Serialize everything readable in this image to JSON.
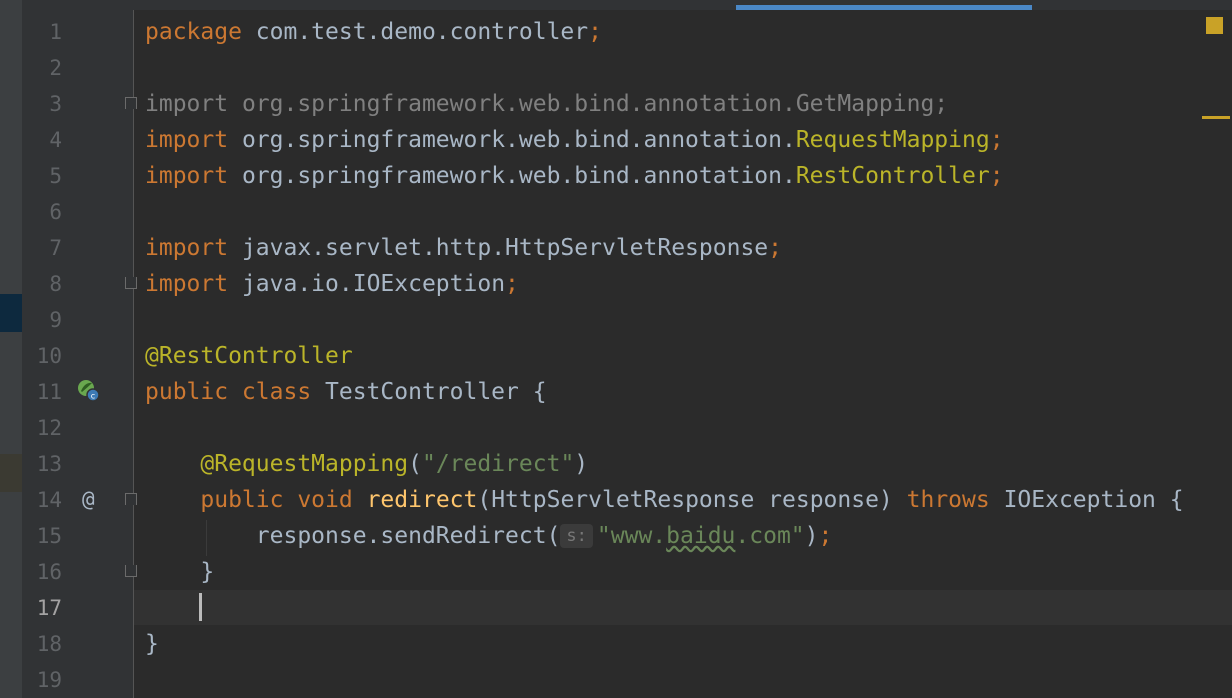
{
  "editor": {
    "line_numbers": [
      "1",
      "2",
      "3",
      "4",
      "5",
      "6",
      "7",
      "8",
      "9",
      "10",
      "11",
      "12",
      "13",
      "14",
      "15",
      "16",
      "17",
      "18",
      "19"
    ],
    "current_line": "17",
    "lines": [
      {
        "tokens": [
          {
            "t": "package",
            "c": "kw"
          },
          {
            "t": " com.test.demo.controller",
            "c": ""
          },
          {
            "t": ";",
            "c": "kw"
          }
        ]
      },
      {
        "tokens": []
      },
      {
        "tokens": [
          {
            "t": "import",
            "c": "dim"
          },
          {
            "t": " org.springframework.web.bind.annotation.GetMapping;",
            "c": "dim"
          }
        ]
      },
      {
        "tokens": [
          {
            "t": "import",
            "c": "kw"
          },
          {
            "t": " org.springframework.web.bind.annotation.",
            "c": ""
          },
          {
            "t": "RequestMapping",
            "c": "ann"
          },
          {
            "t": ";",
            "c": "kw"
          }
        ]
      },
      {
        "tokens": [
          {
            "t": "import",
            "c": "kw"
          },
          {
            "t": " org.springframework.web.bind.annotation.",
            "c": ""
          },
          {
            "t": "RestController",
            "c": "ann"
          },
          {
            "t": ";",
            "c": "kw"
          }
        ]
      },
      {
        "tokens": []
      },
      {
        "tokens": [
          {
            "t": "import",
            "c": "kw"
          },
          {
            "t": " javax.servlet.http.HttpServletResponse",
            "c": ""
          },
          {
            "t": ";",
            "c": "kw"
          }
        ]
      },
      {
        "tokens": [
          {
            "t": "import",
            "c": "kw"
          },
          {
            "t": " java.io.IOException",
            "c": ""
          },
          {
            "t": ";",
            "c": "kw"
          }
        ]
      },
      {
        "tokens": []
      },
      {
        "tokens": [
          {
            "t": "@RestController",
            "c": "ann"
          }
        ]
      },
      {
        "tokens": [
          {
            "t": "public class",
            "c": "kw"
          },
          {
            "t": " TestController {",
            "c": ""
          }
        ]
      },
      {
        "tokens": []
      },
      {
        "tokens": [
          {
            "t": "    ",
            "c": ""
          },
          {
            "t": "@RequestMapping",
            "c": "ann"
          },
          {
            "t": "(",
            "c": ""
          },
          {
            "t": "\"/redirect\"",
            "c": "str"
          },
          {
            "t": ")",
            "c": ""
          }
        ]
      },
      {
        "tokens": [
          {
            "t": "    ",
            "c": ""
          },
          {
            "t": "public void",
            "c": "kw"
          },
          {
            "t": " ",
            "c": ""
          },
          {
            "t": "redirect",
            "c": "fn"
          },
          {
            "t": "(HttpServletResponse response) ",
            "c": ""
          },
          {
            "t": "throws",
            "c": "kw"
          },
          {
            "t": " IOException {",
            "c": ""
          }
        ]
      },
      {
        "tokens": [
          {
            "t": "        response.sendRedirect(",
            "c": ""
          },
          {
            "t": "s:",
            "c": "hint"
          },
          {
            "t": "\"www.",
            "c": "str"
          },
          {
            "t": "baidu",
            "c": "str typo"
          },
          {
            "t": ".com\"",
            "c": "str"
          },
          {
            "t": ")",
            "c": ""
          },
          {
            "t": ";",
            "c": "kw"
          }
        ]
      },
      {
        "tokens": [
          {
            "t": "    }",
            "c": ""
          }
        ]
      },
      {
        "tokens": []
      },
      {
        "tokens": [
          {
            "t": "}",
            "c": ""
          }
        ]
      },
      {
        "tokens": []
      }
    ],
    "gutter_icons": {
      "spring_bean": "spring-bean-icon",
      "at_sign": "@"
    },
    "colors": {
      "keyword": "#cc7832",
      "annotation": "#bbb529",
      "string": "#6a8759",
      "method": "#ffc66d",
      "text": "#a9b7c6",
      "background": "#2b2b2b"
    }
  }
}
